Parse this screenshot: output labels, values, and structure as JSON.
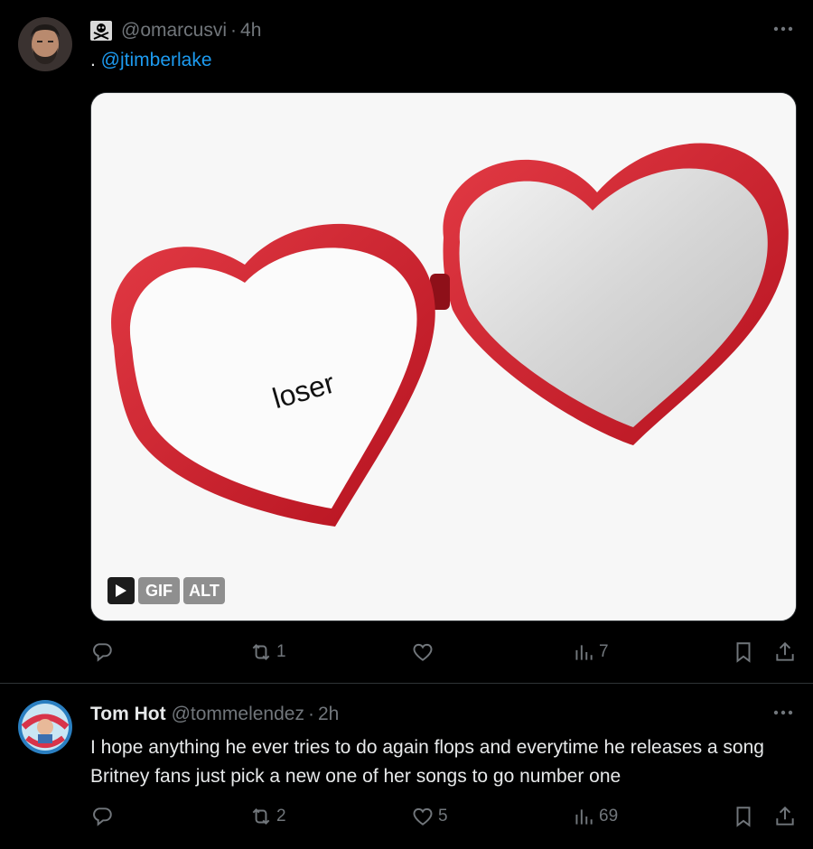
{
  "post1": {
    "handle": "@omarcusvi",
    "time": "4h",
    "text_prefix": ". ",
    "mention": "@jtimberlake",
    "media": {
      "caption": "loser",
      "badge_gif": "GIF",
      "badge_alt": "ALT"
    },
    "actions": {
      "reply_count": "",
      "retweet_count": "1",
      "like_count": "",
      "views_count": "7"
    }
  },
  "post2": {
    "name": "Tom Hot",
    "handle": "@tommelendez",
    "time": "2h",
    "text": "I hope anything he ever tries to do again flops and everytime he releases a song Britney fans just pick a new one of her songs to go number one",
    "actions": {
      "reply_count": "",
      "retweet_count": "2",
      "like_count": "5",
      "views_count": "69"
    }
  },
  "colors": {
    "background": "#000000",
    "text": "#e7e9ea",
    "muted": "#71767b",
    "link": "#1d9bf0",
    "heart_red": "#d11d2b"
  }
}
